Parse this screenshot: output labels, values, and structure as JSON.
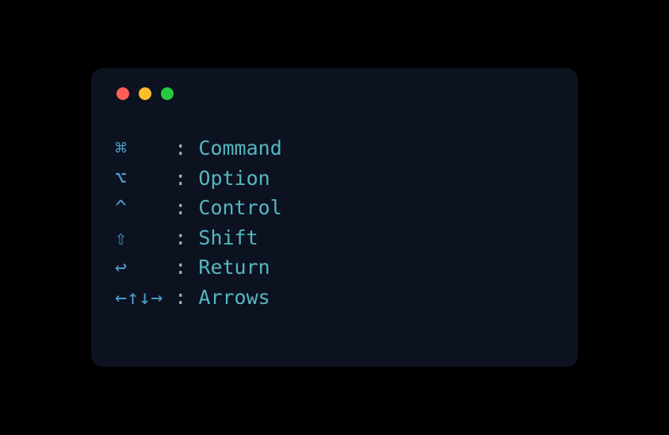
{
  "rows": [
    {
      "symbol": "⌘",
      "pad": "    ",
      "name": "Command"
    },
    {
      "symbol": "⌥",
      "pad": "    ",
      "name": "Option"
    },
    {
      "symbol": "^",
      "pad": "    ",
      "name": "Control"
    },
    {
      "symbol": "⇧",
      "pad": "    ",
      "name": "Shift"
    },
    {
      "symbol": "↩",
      "pad": "    ",
      "name": "Return"
    },
    {
      "symbol": "←↑↓→",
      "pad": " ",
      "name": "Arrows"
    }
  ],
  "separator": ": "
}
